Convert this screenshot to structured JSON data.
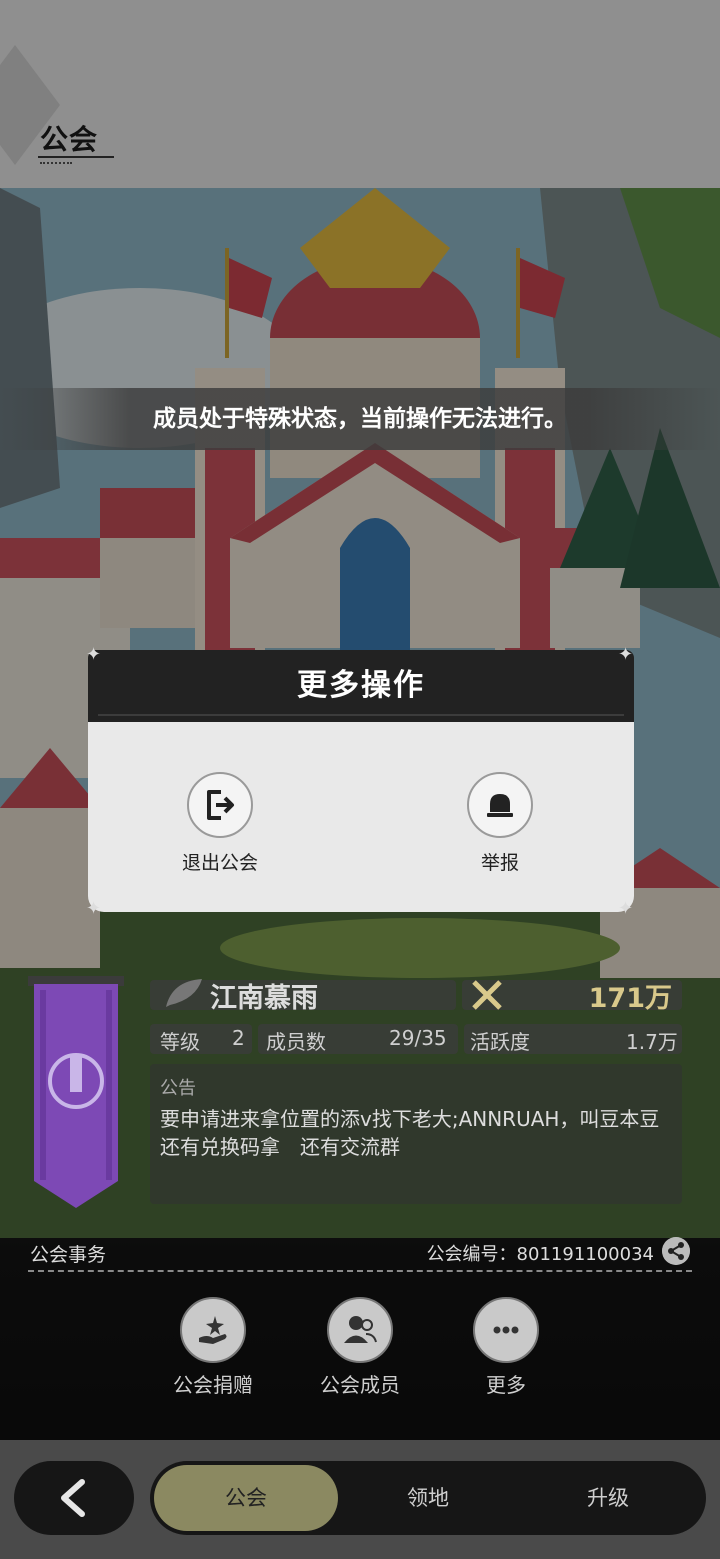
{
  "header": {
    "title": "公会"
  },
  "toast": {
    "message": "成员处于特殊状态，当前操作无法进行。"
  },
  "modal": {
    "title": "更多操作",
    "actions": [
      {
        "label": "退出公会",
        "icon": "exit-icon"
      },
      {
        "label": "举报",
        "icon": "alarm-bell-icon"
      }
    ]
  },
  "guild": {
    "name": "江南慕雨",
    "funds": "171万",
    "level_label": "等级",
    "level": "2",
    "members_label": "成员数",
    "members": "29/35",
    "activity_label": "活跃度",
    "activity": "1.7万",
    "notice_label": "公告",
    "notice": "要申请进来拿位置的添v找下老大;ANNRUAH，叫豆本豆 还有兑换码拿　还有交流群"
  },
  "affairs": {
    "title": "公会事务",
    "id_text": "公会编号：801191100034",
    "actions": [
      {
        "label": "公会捐赠",
        "icon": "donate-icon"
      },
      {
        "label": "公会成员",
        "icon": "members-icon"
      },
      {
        "label": "更多",
        "icon": "more-icon"
      }
    ]
  },
  "nav": {
    "tabs": [
      {
        "label": "公会",
        "active": true
      },
      {
        "label": "领地",
        "active": false
      },
      {
        "label": "升级",
        "active": false
      }
    ]
  },
  "colors": {
    "accent": "#8b8961",
    "fund_gold": "#d9c98b",
    "banner_purple": "#7d49b5"
  }
}
